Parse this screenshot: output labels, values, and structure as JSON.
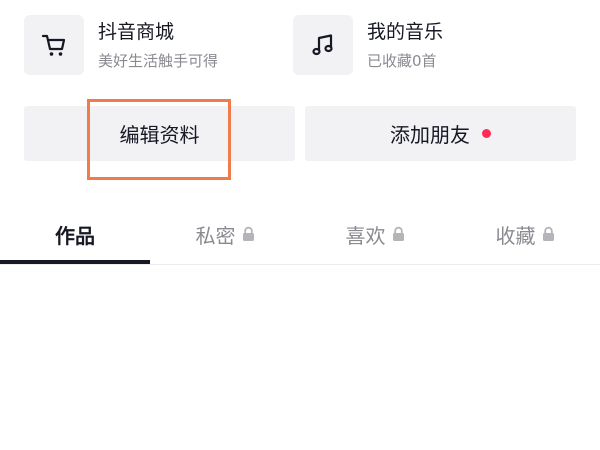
{
  "shortcuts": [
    {
      "title": "抖音商城",
      "subtitle": "美好生活触手可得",
      "icon": "shopping-cart-icon"
    },
    {
      "title": "我的音乐",
      "subtitle": "已收藏0首",
      "icon": "music-note-icon"
    }
  ],
  "actions": {
    "edit_profile": "编辑资料",
    "add_friends": "添加朋友"
  },
  "tabs": [
    {
      "label": "作品",
      "active": true,
      "locked": false
    },
    {
      "label": "私密",
      "active": false,
      "locked": true
    },
    {
      "label": "喜欢",
      "active": false,
      "locked": true
    },
    {
      "label": "收藏",
      "active": false,
      "locked": true
    }
  ],
  "colors": {
    "highlight": "#f07c4c",
    "notification_dot": "#fe2c55",
    "active_tab": "#161823",
    "inactive_tab": "#8a8b91"
  }
}
